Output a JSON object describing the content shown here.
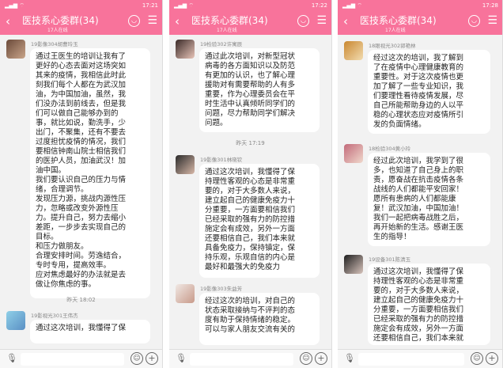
{
  "group": {
    "title": "医技系心委群(34)",
    "online": "17人在线",
    "back_icon": "‹",
    "menu_icon": "☰"
  },
  "phones": [
    {
      "time": "17:21",
      "messages": [
        {
          "sender": "19影像304胡曹玲玉",
          "text": "通过王医生的培训让我有了\n更好的心态去面对这场突如\n其来的疫情，我相信此时此\n刻我们每个人都在为武汉加\n油，为中国加油，虽然，我\n们没办法到前线去，但是我\n们可以做自己能够办到的\n事，就比如说，勤洗手，少\n出门，不聚集，还有不要去\n过度担忧疫情的情况，我们\n要相信钟南山院士相信我们\n的医护人员，加油武汉！加\n油中国。\n我们要认识自己的压力与情\n绪，合理调节。\n发现压力源，挑战内源性压\n力，忽略或改变外源性压\n力。提升自己，努力去缩小\n差距，一步步去实现自己的\n目标。\n和压力做朋友。\n合理安排时间。劳逸结合，\n专时专用，提高效率。\n应对焦虑最好的办法就是去\n做让你焦虑的事。"
        },
        {
          "sender": "19影视光301王伟杰",
          "text": "通过这次培训，我懂得了保"
        }
      ],
      "timesep": "昨天 18:02"
    },
    {
      "time": "17:22",
      "messages": [
        {
          "sender": "19检验302许寓辰",
          "text": "通过此次培训，对新型冠状\n病毒的各方面知识以及防范\n有更加的认识，也了解心理\n援助对有需要帮助的人有多\n重要，作为心理委员会在平\n时生活中认真倾听同学们的\n问题，尽力帮助同学们解决\n问题。"
        },
        {
          "sender": "19影像301林晓钦",
          "text": "通过这次培训，我懂得了保\n持理性客观的心态是非常重\n要的，对于大多数人来说，\n建立起自己的健康免疫力十\n分重要，一方面要相信我们\n已经采取的强有力的防控措\n施定会有成效，另外一方面\n还要相信自己，我们本来就\n具备免疫力，保持镇定，保\n持乐观，乐观自信的内心是\n最好和最强大的免疫力"
        },
        {
          "sender": "19影像303朱益芳",
          "text": "经过这次的培训，对自己的\n状态采取接纳与不评判的态\n度有助于保持情绪的稳定。\n可以与家人朋友交流有关的"
        }
      ],
      "timesep": "昨天 17:19"
    },
    {
      "time": "17:28",
      "messages": [
        {
          "sender": "18眼视光302郭艳林",
          "text": "经过这次的培训，我了解到\n了在疫情中心理健康教育的\n重要性。对于这次疫情也更\n加了解了一些专业知识，我\n们要理性看待疫情发展，尽\n自己所能帮助身边的人以平\n稳的心理状态应对疫情所引\n发的负面情绪。"
        },
        {
          "sender": "18检验304黄小玲",
          "text": "经过此次培训，我学到了很\n多，也知道了自己身上的职\n责，愿奋战在抗击疫情各条\n战线的人们都能平安回家！\n愿所有患病的人们都能康\n复！武汉加油，中国加油！\n我们一起把病毒战胜之后，\n再开始新的生活。感谢王医\n生的指导！"
        },
        {
          "sender": "19设备301陈清玉",
          "text": "通过这次培训，我懂得了保\n持理性客观的心态是非常重\n要的，对于大多数人来说，\n建立起自己的健康免疫力十\n分重要，一方面要相信我们\n已经采取的强有力的防控措\n施定会有成效，另外一方面\n还要相信自己，我们本来就"
        }
      ],
      "timesep": ""
    }
  ]
}
